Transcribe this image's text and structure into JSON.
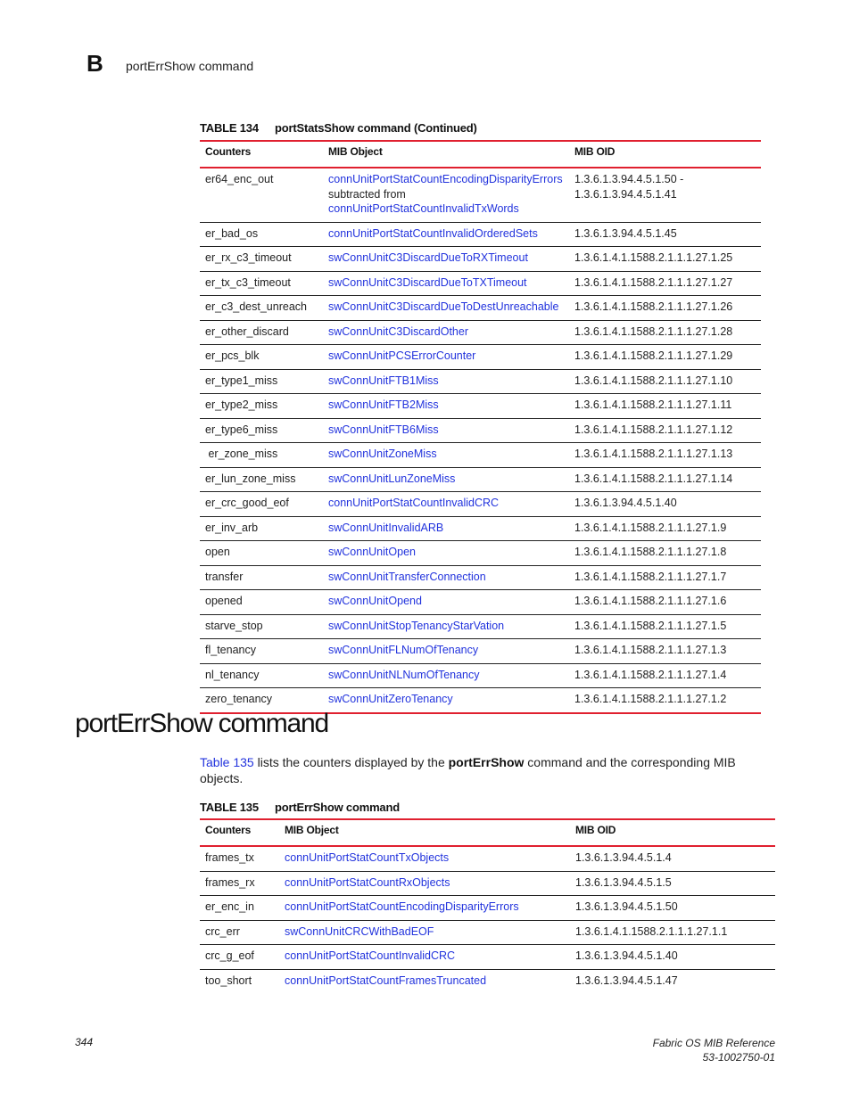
{
  "header": {
    "chapter_letter": "B",
    "running_head": "portErrShow command"
  },
  "table134": {
    "number": "TABLE 134",
    "title": "portStatsShow command (Continued)",
    "columns": [
      "Counters",
      "MIB Object",
      "MIB OID"
    ],
    "first_row": {
      "counter": "er64_enc_out",
      "mib_object_line1": "connUnitPortStatCountEncodingDisparityErrors",
      "mib_object_line2": "subtracted from",
      "mib_object_line3": "connUnitPortStatCountInvalidTxWords",
      "oid_line1": "1.3.6.1.3.94.4.5.1.50 -",
      "oid_line2": "1.3.6.1.3.94.4.5.1.41"
    },
    "rows": [
      {
        "counter": "er_bad_os",
        "mib_object": "connUnitPortStatCountInvalidOrderedSets",
        "oid": "1.3.6.1.3.94.4.5.1.45"
      },
      {
        "counter": "er_rx_c3_timeout",
        "mib_object": "swConnUnitC3DiscardDueToRXTimeout",
        "oid": "1.3.6.1.4.1.1588.2.1.1.1.27.1.25"
      },
      {
        "counter": "er_tx_c3_timeout",
        "mib_object": "swConnUnitC3DiscardDueToTXTimeout",
        "oid": "1.3.6.1.4.1.1588.2.1.1.1.27.1.27"
      },
      {
        "counter": "er_c3_dest_unreach",
        "mib_object": "swConnUnitC3DiscardDueToDestUnreachable",
        "oid": "1.3.6.1.4.1.1588.2.1.1.1.27.1.26"
      },
      {
        "counter": "er_other_discard",
        "mib_object": "swConnUnitC3DiscardOther",
        "oid": "1.3.6.1.4.1.1588.2.1.1.1.27.1.28"
      },
      {
        "counter": "er_pcs_blk",
        "mib_object": "swConnUnitPCSErrorCounter",
        "oid": "1.3.6.1.4.1.1588.2.1.1.1.27.1.29"
      },
      {
        "counter": "er_type1_miss",
        "mib_object": "swConnUnitFTB1Miss",
        "oid": "1.3.6.1.4.1.1588.2.1.1.1.27.1.10"
      },
      {
        "counter": "er_type2_miss",
        "mib_object": "swConnUnitFTB2Miss",
        "oid": "1.3.6.1.4.1.1588.2.1.1.1.27.1.11"
      },
      {
        "counter": "er_type6_miss",
        "mib_object": "swConnUnitFTB6Miss",
        "oid": "1.3.6.1.4.1.1588.2.1.1.1.27.1.12"
      },
      {
        "counter": " er_zone_miss",
        "mib_object": "swConnUnitZoneMiss",
        "oid": "1.3.6.1.4.1.1588.2.1.1.1.27.1.13"
      },
      {
        "counter": "er_lun_zone_miss",
        "mib_object": "swConnUnitLunZoneMiss",
        "oid": "1.3.6.1.4.1.1588.2.1.1.1.27.1.14"
      },
      {
        "counter": "er_crc_good_eof",
        "mib_object": "connUnitPortStatCountInvalidCRC",
        "oid": "1.3.6.1.3.94.4.5.1.40"
      },
      {
        "counter": "er_inv_arb",
        "mib_object": "swConnUnitInvalidARB",
        "oid": "1.3.6.1.4.1.1588.2.1.1.1.27.1.9"
      },
      {
        "counter": "open",
        "mib_object": "swConnUnitOpen",
        "oid": "1.3.6.1.4.1.1588.2.1.1.1.27.1.8"
      },
      {
        "counter": "transfer",
        "mib_object": "swConnUnitTransferConnection",
        "oid": "1.3.6.1.4.1.1588.2.1.1.1.27.1.7"
      },
      {
        "counter": "opened",
        "mib_object": "swConnUnitOpend",
        "oid": "1.3.6.1.4.1.1588.2.1.1.1.27.1.6"
      },
      {
        "counter": "starve_stop",
        "mib_object": "swConnUnitStopTenancyStarVation",
        "oid": "1.3.6.1.4.1.1588.2.1.1.1.27.1.5"
      },
      {
        "counter": "fl_tenancy",
        "mib_object": "swConnUnitFLNumOfTenancy",
        "oid": "1.3.6.1.4.1.1588.2.1.1.1.27.1.3"
      },
      {
        "counter": "nl_tenancy",
        "mib_object": "swConnUnitNLNumOfTenancy",
        "oid": "1.3.6.1.4.1.1588.2.1.1.1.27.1.4"
      },
      {
        "counter": "zero_tenancy",
        "mib_object": "swConnUnitZeroTenancy",
        "oid": "1.3.6.1.4.1.1588.2.1.1.1.27.1.2"
      }
    ]
  },
  "section": {
    "heading": "portErrShow command",
    "intro_link": "Table 135",
    "intro_text1": " lists the counters displayed by the ",
    "intro_bold": "portErrShow",
    "intro_text2": " command and the corresponding MIB objects."
  },
  "table135": {
    "number": "TABLE 135",
    "title": "portErrShow command",
    "columns": [
      "Counters",
      "MIB Object",
      "MIB OID"
    ],
    "rows": [
      {
        "counter": "frames_tx",
        "mib_object": "connUnitPortStatCountTxObjects",
        "oid": "1.3.6.1.3.94.4.5.1.4"
      },
      {
        "counter": "frames_rx",
        "mib_object": "connUnitPortStatCountRxObjects",
        "oid": "1.3.6.1.3.94.4.5.1.5"
      },
      {
        "counter": "er_enc_in",
        "mib_object": "connUnitPortStatCountEncodingDisparityErrors",
        "oid": "1.3.6.1.3.94.4.5.1.50"
      },
      {
        "counter": "crc_err",
        "mib_object": "swConnUnitCRCWithBadEOF",
        "oid": "1.3.6.1.4.1.1588.2.1.1.1.27.1.1"
      },
      {
        "counter": "crc_g_eof",
        "mib_object": "connUnitPortStatCountInvalidCRC",
        "oid": "1.3.6.1.3.94.4.5.1.40"
      },
      {
        "counter": "too_short",
        "mib_object": "connUnitPortStatCountFramesTruncated",
        "oid": "1.3.6.1.3.94.4.5.1.47"
      }
    ]
  },
  "footer": {
    "page_number": "344",
    "doc_title": "Fabric OS MIB Reference",
    "doc_number": "53-1002750-01"
  },
  "colors": {
    "rule_red": "#e0202f",
    "link_blue": "#2233dd"
  }
}
